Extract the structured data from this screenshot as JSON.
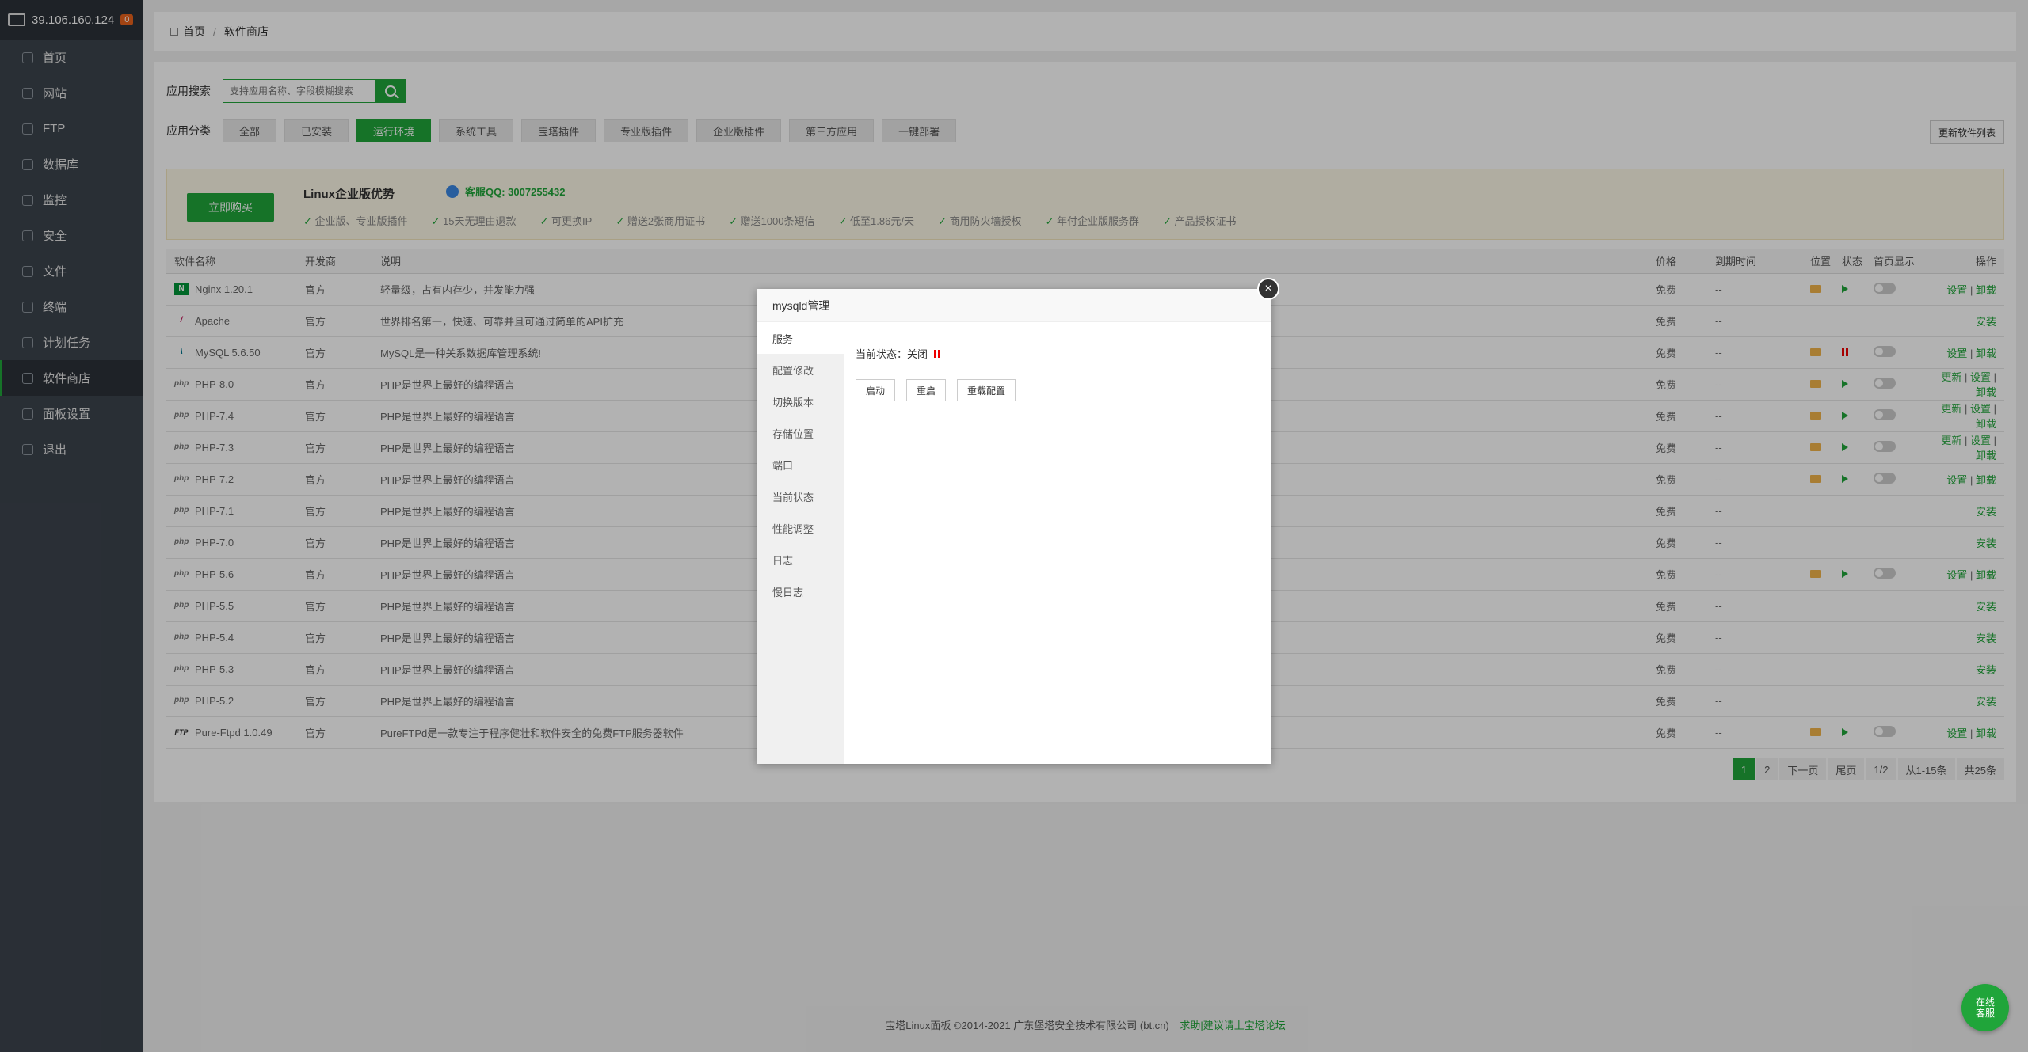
{
  "sidebar": {
    "ip": "39.106.160.124",
    "badge": "0",
    "items": [
      {
        "label": "首页",
        "icon": "home-icon"
      },
      {
        "label": "网站",
        "icon": "globe-icon"
      },
      {
        "label": "FTP",
        "icon": "ftp-icon"
      },
      {
        "label": "数据库",
        "icon": "database-icon"
      },
      {
        "label": "监控",
        "icon": "monitor-icon"
      },
      {
        "label": "安全",
        "icon": "shield-icon"
      },
      {
        "label": "文件",
        "icon": "folder-icon"
      },
      {
        "label": "终端",
        "icon": "terminal-icon"
      },
      {
        "label": "计划任务",
        "icon": "calendar-icon"
      },
      {
        "label": "软件商店",
        "icon": "grid-icon"
      },
      {
        "label": "面板设置",
        "icon": "gear-icon"
      },
      {
        "label": "退出",
        "icon": "logout-icon"
      }
    ]
  },
  "breadcrumb": {
    "home": "首页",
    "sep": "/",
    "current": "软件商店"
  },
  "search": {
    "label": "应用搜索",
    "placeholder": "支持应用名称、字段模糊搜索"
  },
  "categories": {
    "label": "应用分类",
    "items": [
      "全部",
      "已安装",
      "运行环境",
      "系统工具",
      "宝塔插件",
      "专业版插件",
      "企业版插件",
      "第三方应用",
      "一键部署"
    ],
    "refresh": "更新软件列表"
  },
  "promo": {
    "buy": "立即购买",
    "title": "Linux企业版优势",
    "qq": "客服QQ: 3007255432",
    "features": [
      "企业版、专业版插件",
      "15天无理由退款",
      "可更换IP",
      "赠送2张商用证书",
      "赠送1000条短信",
      "低至1.86元/天",
      "商用防火墙授权",
      "年付企业版服务群",
      "产品授权证书"
    ]
  },
  "table": {
    "headers": [
      "软件名称",
      "开发商",
      "说明",
      "价格",
      "到期时间",
      "位置",
      "状态",
      "首页显示",
      "操作"
    ],
    "rows": [
      {
        "logo": "N",
        "logo_type": "nginx",
        "name": "Nginx 1.20.1",
        "vendor": "官方",
        "desc": "轻量级，占有内存少，并发能力强",
        "price": "免费",
        "expire": "--",
        "installed": "yes",
        "state": "play",
        "op1": "设置",
        "op2": "卸载",
        "op0": ""
      },
      {
        "logo": "/",
        "logo_type": "apache",
        "name": "Apache",
        "vendor": "官方",
        "desc": "世界排名第一，快速、可靠并且可通过简单的API扩充",
        "price": "免费",
        "expire": "--",
        "installed": "no",
        "op_install": "安装"
      },
      {
        "logo": "\\",
        "logo_type": "mysql",
        "name": "MySQL 5.6.50",
        "vendor": "官方",
        "desc": "MySQL是一种关系数据库管理系统!",
        "price": "免费",
        "expire": "--",
        "installed": "yes",
        "state": "pause",
        "op1": "设置",
        "op2": "卸载",
        "op0": ""
      },
      {
        "logo": "php",
        "logo_type": "php",
        "name": "PHP-8.0",
        "vendor": "官方",
        "desc": "PHP是世界上最好的编程语言",
        "price": "免费",
        "expire": "--",
        "installed": "yes",
        "state": "play",
        "op0": "更新",
        "op1": "设置",
        "op2": "卸载"
      },
      {
        "logo": "php",
        "logo_type": "php",
        "name": "PHP-7.4",
        "vendor": "官方",
        "desc": "PHP是世界上最好的编程语言",
        "price": "免费",
        "expire": "--",
        "installed": "yes",
        "state": "play",
        "op0": "更新",
        "op1": "设置",
        "op2": "卸载"
      },
      {
        "logo": "php",
        "logo_type": "php",
        "name": "PHP-7.3",
        "vendor": "官方",
        "desc": "PHP是世界上最好的编程语言",
        "price": "免费",
        "expire": "--",
        "installed": "yes",
        "state": "play",
        "op0": "更新",
        "op1": "设置",
        "op2": "卸载"
      },
      {
        "logo": "php",
        "logo_type": "php",
        "name": "PHP-7.2",
        "vendor": "官方",
        "desc": "PHP是世界上最好的编程语言",
        "price": "免费",
        "expire": "--",
        "installed": "yes",
        "state": "play",
        "op0": "",
        "op1": "设置",
        "op2": "卸载"
      },
      {
        "logo": "php",
        "logo_type": "php",
        "name": "PHP-7.1",
        "vendor": "官方",
        "desc": "PHP是世界上最好的编程语言",
        "price": "免费",
        "expire": "--",
        "installed": "no",
        "op_install": "安装"
      },
      {
        "logo": "php",
        "logo_type": "php",
        "name": "PHP-7.0",
        "vendor": "官方",
        "desc": "PHP是世界上最好的编程语言",
        "price": "免费",
        "expire": "--",
        "installed": "no",
        "op_install": "安装"
      },
      {
        "logo": "php",
        "logo_type": "php",
        "name": "PHP-5.6",
        "vendor": "官方",
        "desc": "PHP是世界上最好的编程语言",
        "price": "免费",
        "expire": "--",
        "installed": "yes",
        "state": "play",
        "op0": "",
        "op1": "设置",
        "op2": "卸载"
      },
      {
        "logo": "php",
        "logo_type": "php",
        "name": "PHP-5.5",
        "vendor": "官方",
        "desc": "PHP是世界上最好的编程语言",
        "price": "免费",
        "expire": "--",
        "installed": "no",
        "op_install": "安装"
      },
      {
        "logo": "php",
        "logo_type": "php",
        "name": "PHP-5.4",
        "vendor": "官方",
        "desc": "PHP是世界上最好的编程语言",
        "price": "免费",
        "expire": "--",
        "installed": "no",
        "op_install": "安装"
      },
      {
        "logo": "php",
        "logo_type": "php",
        "name": "PHP-5.3",
        "vendor": "官方",
        "desc": "PHP是世界上最好的编程语言",
        "price": "免费",
        "expire": "--",
        "installed": "no",
        "op_install": "安装"
      },
      {
        "logo": "php",
        "logo_type": "php",
        "name": "PHP-5.2",
        "vendor": "官方",
        "desc": "PHP是世界上最好的编程语言",
        "price": "免费",
        "expire": "--",
        "installed": "no",
        "op_install": "安装"
      },
      {
        "logo": "FTP",
        "logo_type": "ftp",
        "name": "Pure-Ftpd 1.0.49",
        "vendor": "官方",
        "desc": "PureFTPd是一款专注于程序健壮和软件安全的免费FTP服务器软件",
        "price": "免费",
        "expire": "--",
        "installed": "yes",
        "state": "play",
        "op0": "",
        "op1": "设置",
        "op2": "卸载"
      }
    ]
  },
  "pager": [
    "1",
    "2",
    "下一页",
    "尾页",
    "1/2",
    "从1-15条",
    "共25条"
  ],
  "footer": {
    "copyright": "宝塔Linux面板 ©2014-2021 广东堡塔安全技术有限公司 (bt.cn)",
    "link": "求助|建议请上宝塔论坛"
  },
  "online_service": "在线客服",
  "modal": {
    "title": "mysqld管理",
    "close": "×",
    "nav": [
      "服务",
      "配置修改",
      "切换版本",
      "存储位置",
      "端口",
      "当前状态",
      "性能调整",
      "日志",
      "慢日志"
    ],
    "status_label": "当前状态：",
    "status_value": "关闭",
    "buttons": [
      "启动",
      "重启",
      "重载配置"
    ]
  },
  "colors": {
    "accent": "#20a53a",
    "sidebar": "#3c444d",
    "promo_bg": "#fdf8e7"
  }
}
